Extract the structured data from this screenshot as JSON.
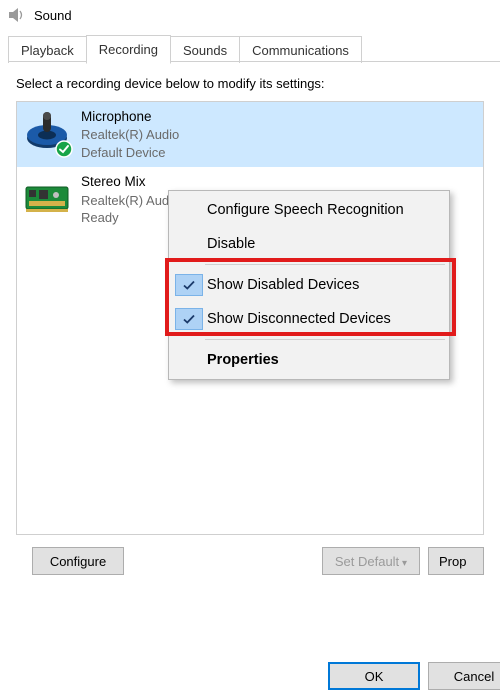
{
  "title": "Sound",
  "tabs": [
    {
      "label": "Playback"
    },
    {
      "label": "Recording"
    },
    {
      "label": "Sounds"
    },
    {
      "label": "Communications"
    }
  ],
  "active_tab_index": 1,
  "instruction": "Select a recording device below to modify its settings:",
  "devices": [
    {
      "name": "Microphone",
      "sub1": "Realtek(R) Audio",
      "sub2": "Default Device",
      "selected": true,
      "status": "default"
    },
    {
      "name": "Stereo Mix",
      "sub1": "Realtek(R) Audio",
      "sub2": "Ready",
      "selected": false,
      "status": "ready"
    }
  ],
  "buttons": {
    "configure": "Configure",
    "set_default": "Set Default",
    "properties": "Properties",
    "properties_trunc": "Prop",
    "ok": "OK",
    "cancel": "Cancel"
  },
  "context_menu": {
    "configure_sr": "Configure Speech Recognition",
    "disable": "Disable",
    "show_disabled": "Show Disabled Devices",
    "show_disconnected": "Show Disconnected Devices",
    "properties": "Properties",
    "show_disabled_checked": true,
    "show_disconnected_checked": true
  }
}
